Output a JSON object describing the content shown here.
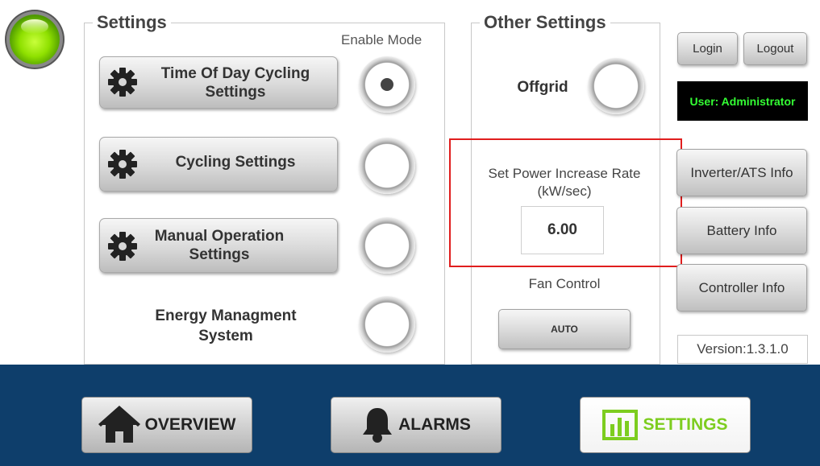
{
  "settings": {
    "title": "Settings",
    "enable_mode_label": "Enable Mode",
    "items": [
      {
        "label": "Time Of Day Cycling Settings",
        "enabled": true
      },
      {
        "label": "Cycling Settings",
        "enabled": false
      },
      {
        "label": "Manual Operation Settings",
        "enabled": false
      }
    ],
    "ems": {
      "label": "Energy Managment System",
      "enabled": false
    }
  },
  "other_settings": {
    "title": "Other Settings",
    "offgrid_label": "Offgrid",
    "offgrid_enabled": false,
    "power_rate_label": "Set Power Increase Rate (kW/sec)",
    "power_rate_value": "6.00",
    "fan_control_label": "Fan Control",
    "fan_button_label": "AUTO"
  },
  "account": {
    "login_label": "Login",
    "logout_label": "Logout",
    "user_text": "User: Administrator"
  },
  "info_buttons": [
    "Inverter/ATS Info",
    "Battery Info",
    "Controller Info"
  ],
  "version": "Version:1.3.1.0",
  "nav": {
    "overview": "OVERVIEW",
    "alarms": "ALARMS",
    "settings": "SETTINGS",
    "active": "settings"
  },
  "colors": {
    "nav_background": "#0e3e6b",
    "active_nav_text": "#7dcd1f",
    "user_text": "#34ff34",
    "highlight": "#e01e1e",
    "status_led": "#8fe000"
  }
}
